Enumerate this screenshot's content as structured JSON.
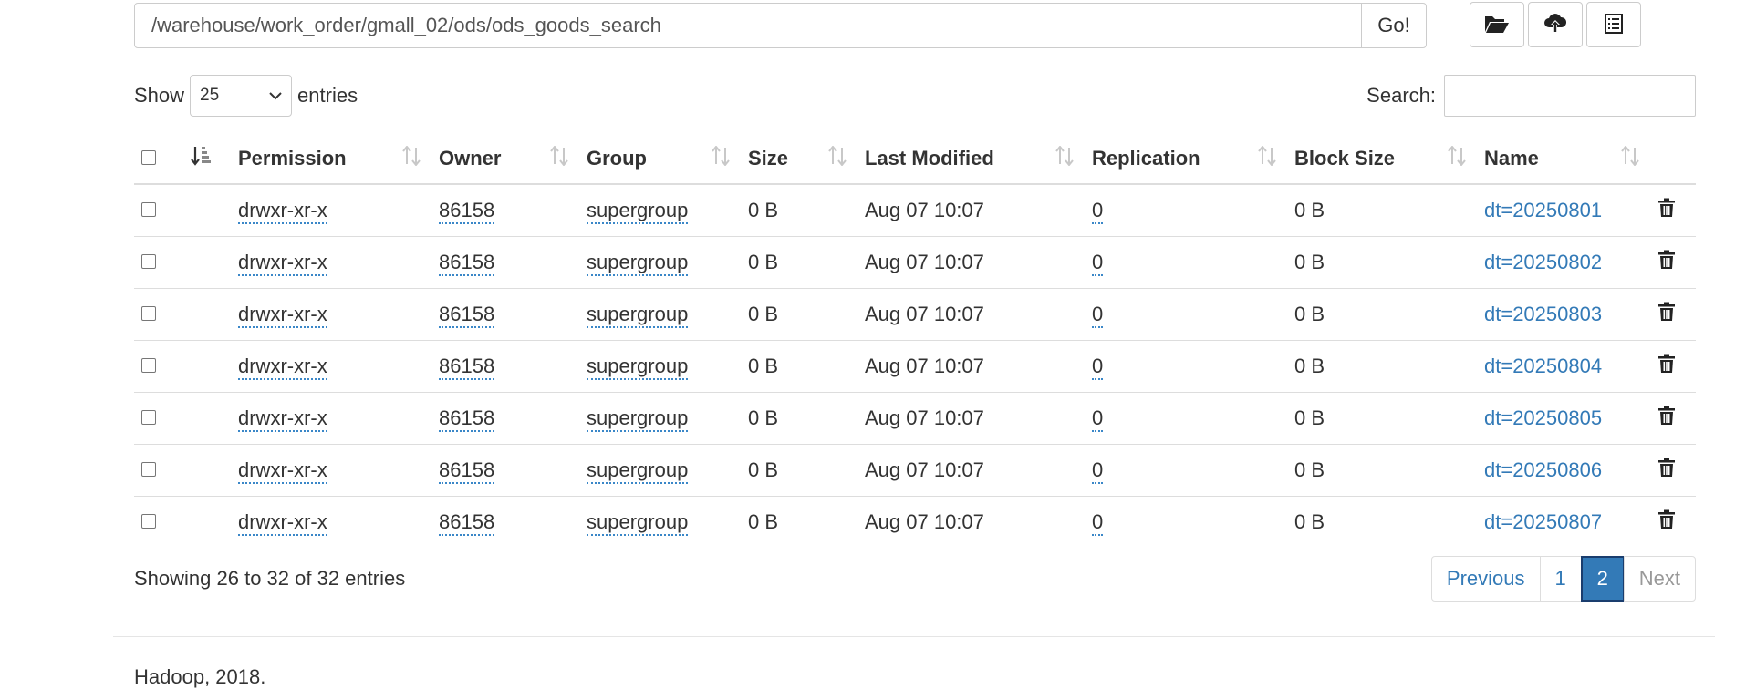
{
  "path_bar": {
    "path": "/warehouse/work_order/gmall_02/ods/ods_goods_search",
    "go_label": "Go!"
  },
  "toolbar": {
    "icons": [
      "folder-open-icon",
      "cloud-upload-icon",
      "list-icon"
    ]
  },
  "length_menu": {
    "show_label": "Show",
    "selected": "25",
    "entries_label": "entries"
  },
  "search": {
    "label": "Search:",
    "value": ""
  },
  "table": {
    "headers": [
      "Permission",
      "Owner",
      "Group",
      "Size",
      "Last Modified",
      "Replication",
      "Block Size",
      "Name"
    ],
    "rows": [
      {
        "permission": "drwxr-xr-x",
        "owner": "86158",
        "group": "supergroup",
        "size": "0 B",
        "modified": "Aug 07 10:07",
        "replication": "0",
        "block_size": "0 B",
        "name": "dt=20250801"
      },
      {
        "permission": "drwxr-xr-x",
        "owner": "86158",
        "group": "supergroup",
        "size": "0 B",
        "modified": "Aug 07 10:07",
        "replication": "0",
        "block_size": "0 B",
        "name": "dt=20250802"
      },
      {
        "permission": "drwxr-xr-x",
        "owner": "86158",
        "group": "supergroup",
        "size": "0 B",
        "modified": "Aug 07 10:07",
        "replication": "0",
        "block_size": "0 B",
        "name": "dt=20250803"
      },
      {
        "permission": "drwxr-xr-x",
        "owner": "86158",
        "group": "supergroup",
        "size": "0 B",
        "modified": "Aug 07 10:07",
        "replication": "0",
        "block_size": "0 B",
        "name": "dt=20250804"
      },
      {
        "permission": "drwxr-xr-x",
        "owner": "86158",
        "group": "supergroup",
        "size": "0 B",
        "modified": "Aug 07 10:07",
        "replication": "0",
        "block_size": "0 B",
        "name": "dt=20250805"
      },
      {
        "permission": "drwxr-xr-x",
        "owner": "86158",
        "group": "supergroup",
        "size": "0 B",
        "modified": "Aug 07 10:07",
        "replication": "0",
        "block_size": "0 B",
        "name": "dt=20250806"
      },
      {
        "permission": "drwxr-xr-x",
        "owner": "86158",
        "group": "supergroup",
        "size": "0 B",
        "modified": "Aug 07 10:07",
        "replication": "0",
        "block_size": "0 B",
        "name": "dt=20250807"
      }
    ]
  },
  "info_text": "Showing 26 to 32 of 32 entries",
  "pagination": {
    "previous": "Previous",
    "pages": [
      "1",
      "2"
    ],
    "current": "2",
    "next": "Next"
  },
  "footer_text": "Hadoop, 2018.",
  "colors": {
    "link": "#337ab7",
    "active_page": "#337ab7",
    "border": "#dddddd"
  }
}
